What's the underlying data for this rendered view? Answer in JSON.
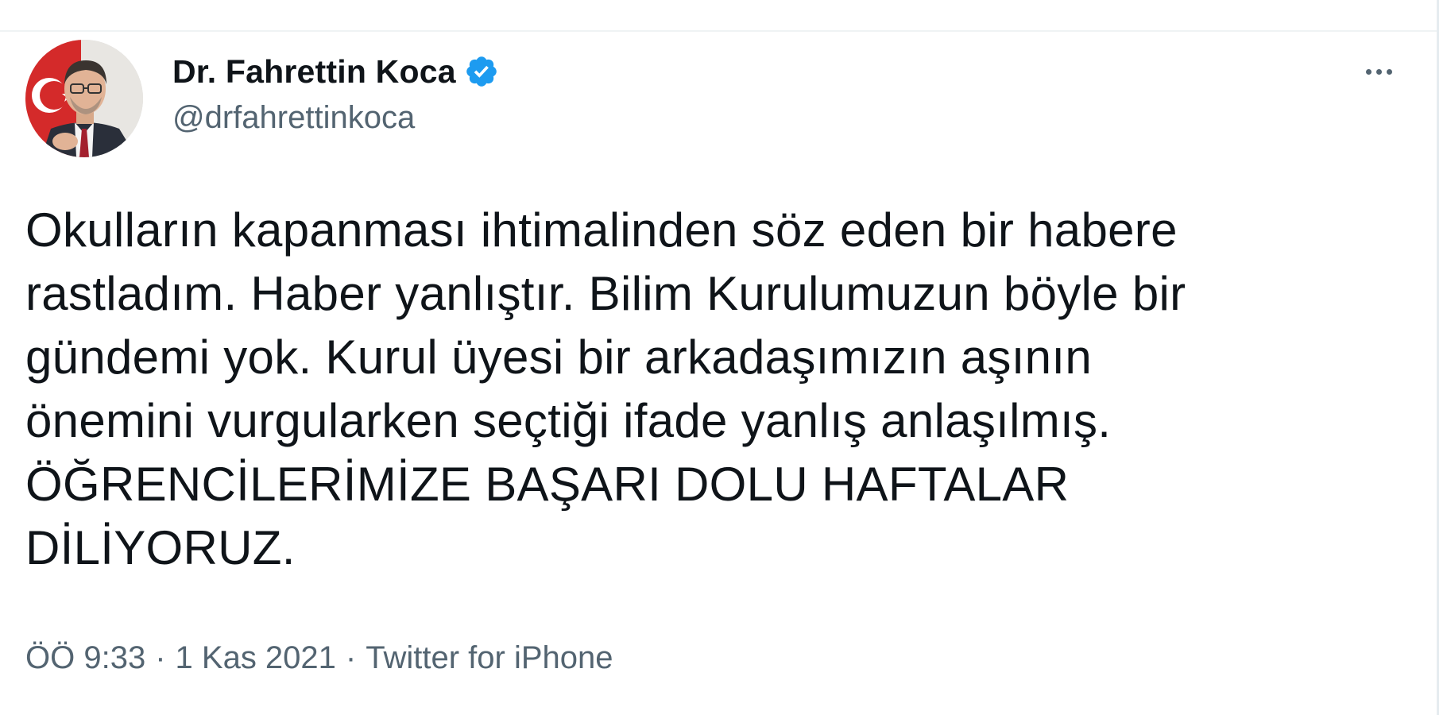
{
  "tweet": {
    "author": {
      "display_name": "Dr. Fahrettin Koca",
      "handle": "@drfahrettinkoca",
      "verified_icon": "verified-badge-icon",
      "avatar_icon": "profile-photo"
    },
    "more_icon": "more-horizontal-icon",
    "text": "Okulların kapanması ihtimalinden söz eden bir habere\nrastladım. Haber yanlıştır. Bilim Kurulumuzun böyle bir\ngündemi yok. Kurul üyesi bir arkadaşımızın aşının\nönemini vurgularken seçtiği ifade yanlış anlaşılmış.\nÖĞRENCİLERİMİZE BAŞARI DOLU HAFTALAR\nDİLİYORUZ.",
    "meta": {
      "time": "ÖÖ 9:33",
      "separator": "·",
      "date": "1 Kas 2021",
      "source": "Twitter for iPhone"
    }
  },
  "colors": {
    "text_primary": "#0f1419",
    "text_secondary": "#536471",
    "verified_blue": "#1d9bf0",
    "divider": "#eff3f4"
  }
}
